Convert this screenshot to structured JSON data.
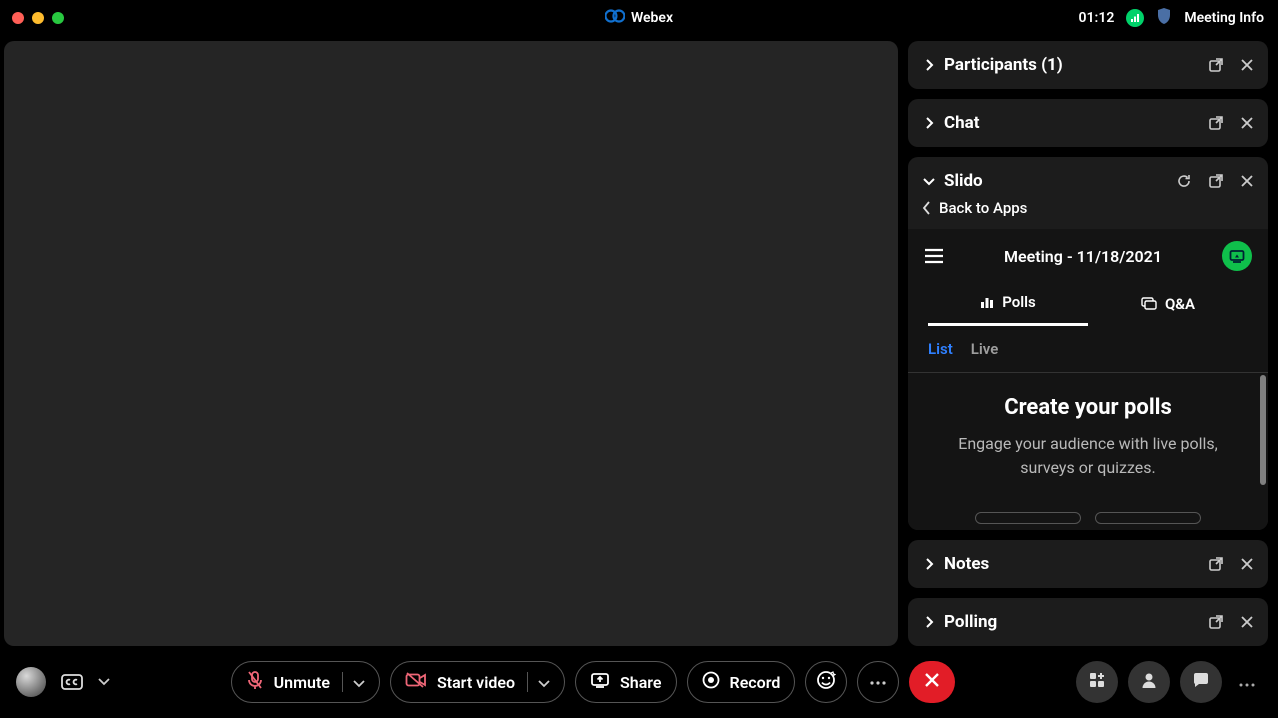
{
  "titlebar": {
    "app_name": "Webex",
    "timer": "01:12",
    "meeting_info": "Meeting Info"
  },
  "sidepanels": {
    "participants": {
      "title": "Participants (1)"
    },
    "chat": {
      "title": "Chat"
    },
    "slido": {
      "title": "Slido",
      "back": "Back to Apps",
      "meeting_title": "Meeting - 11/18/2021",
      "tab_polls": "Polls",
      "tab_qa": "Q&A",
      "sub_list": "List",
      "sub_live": "Live",
      "heading": "Create your polls",
      "subtext": "Engage your audience with live polls, surveys or quizzes."
    },
    "notes": {
      "title": "Notes"
    },
    "polling": {
      "title": "Polling"
    }
  },
  "toolbar": {
    "unmute": "Unmute",
    "start_video": "Start video",
    "share": "Share",
    "record": "Record"
  }
}
